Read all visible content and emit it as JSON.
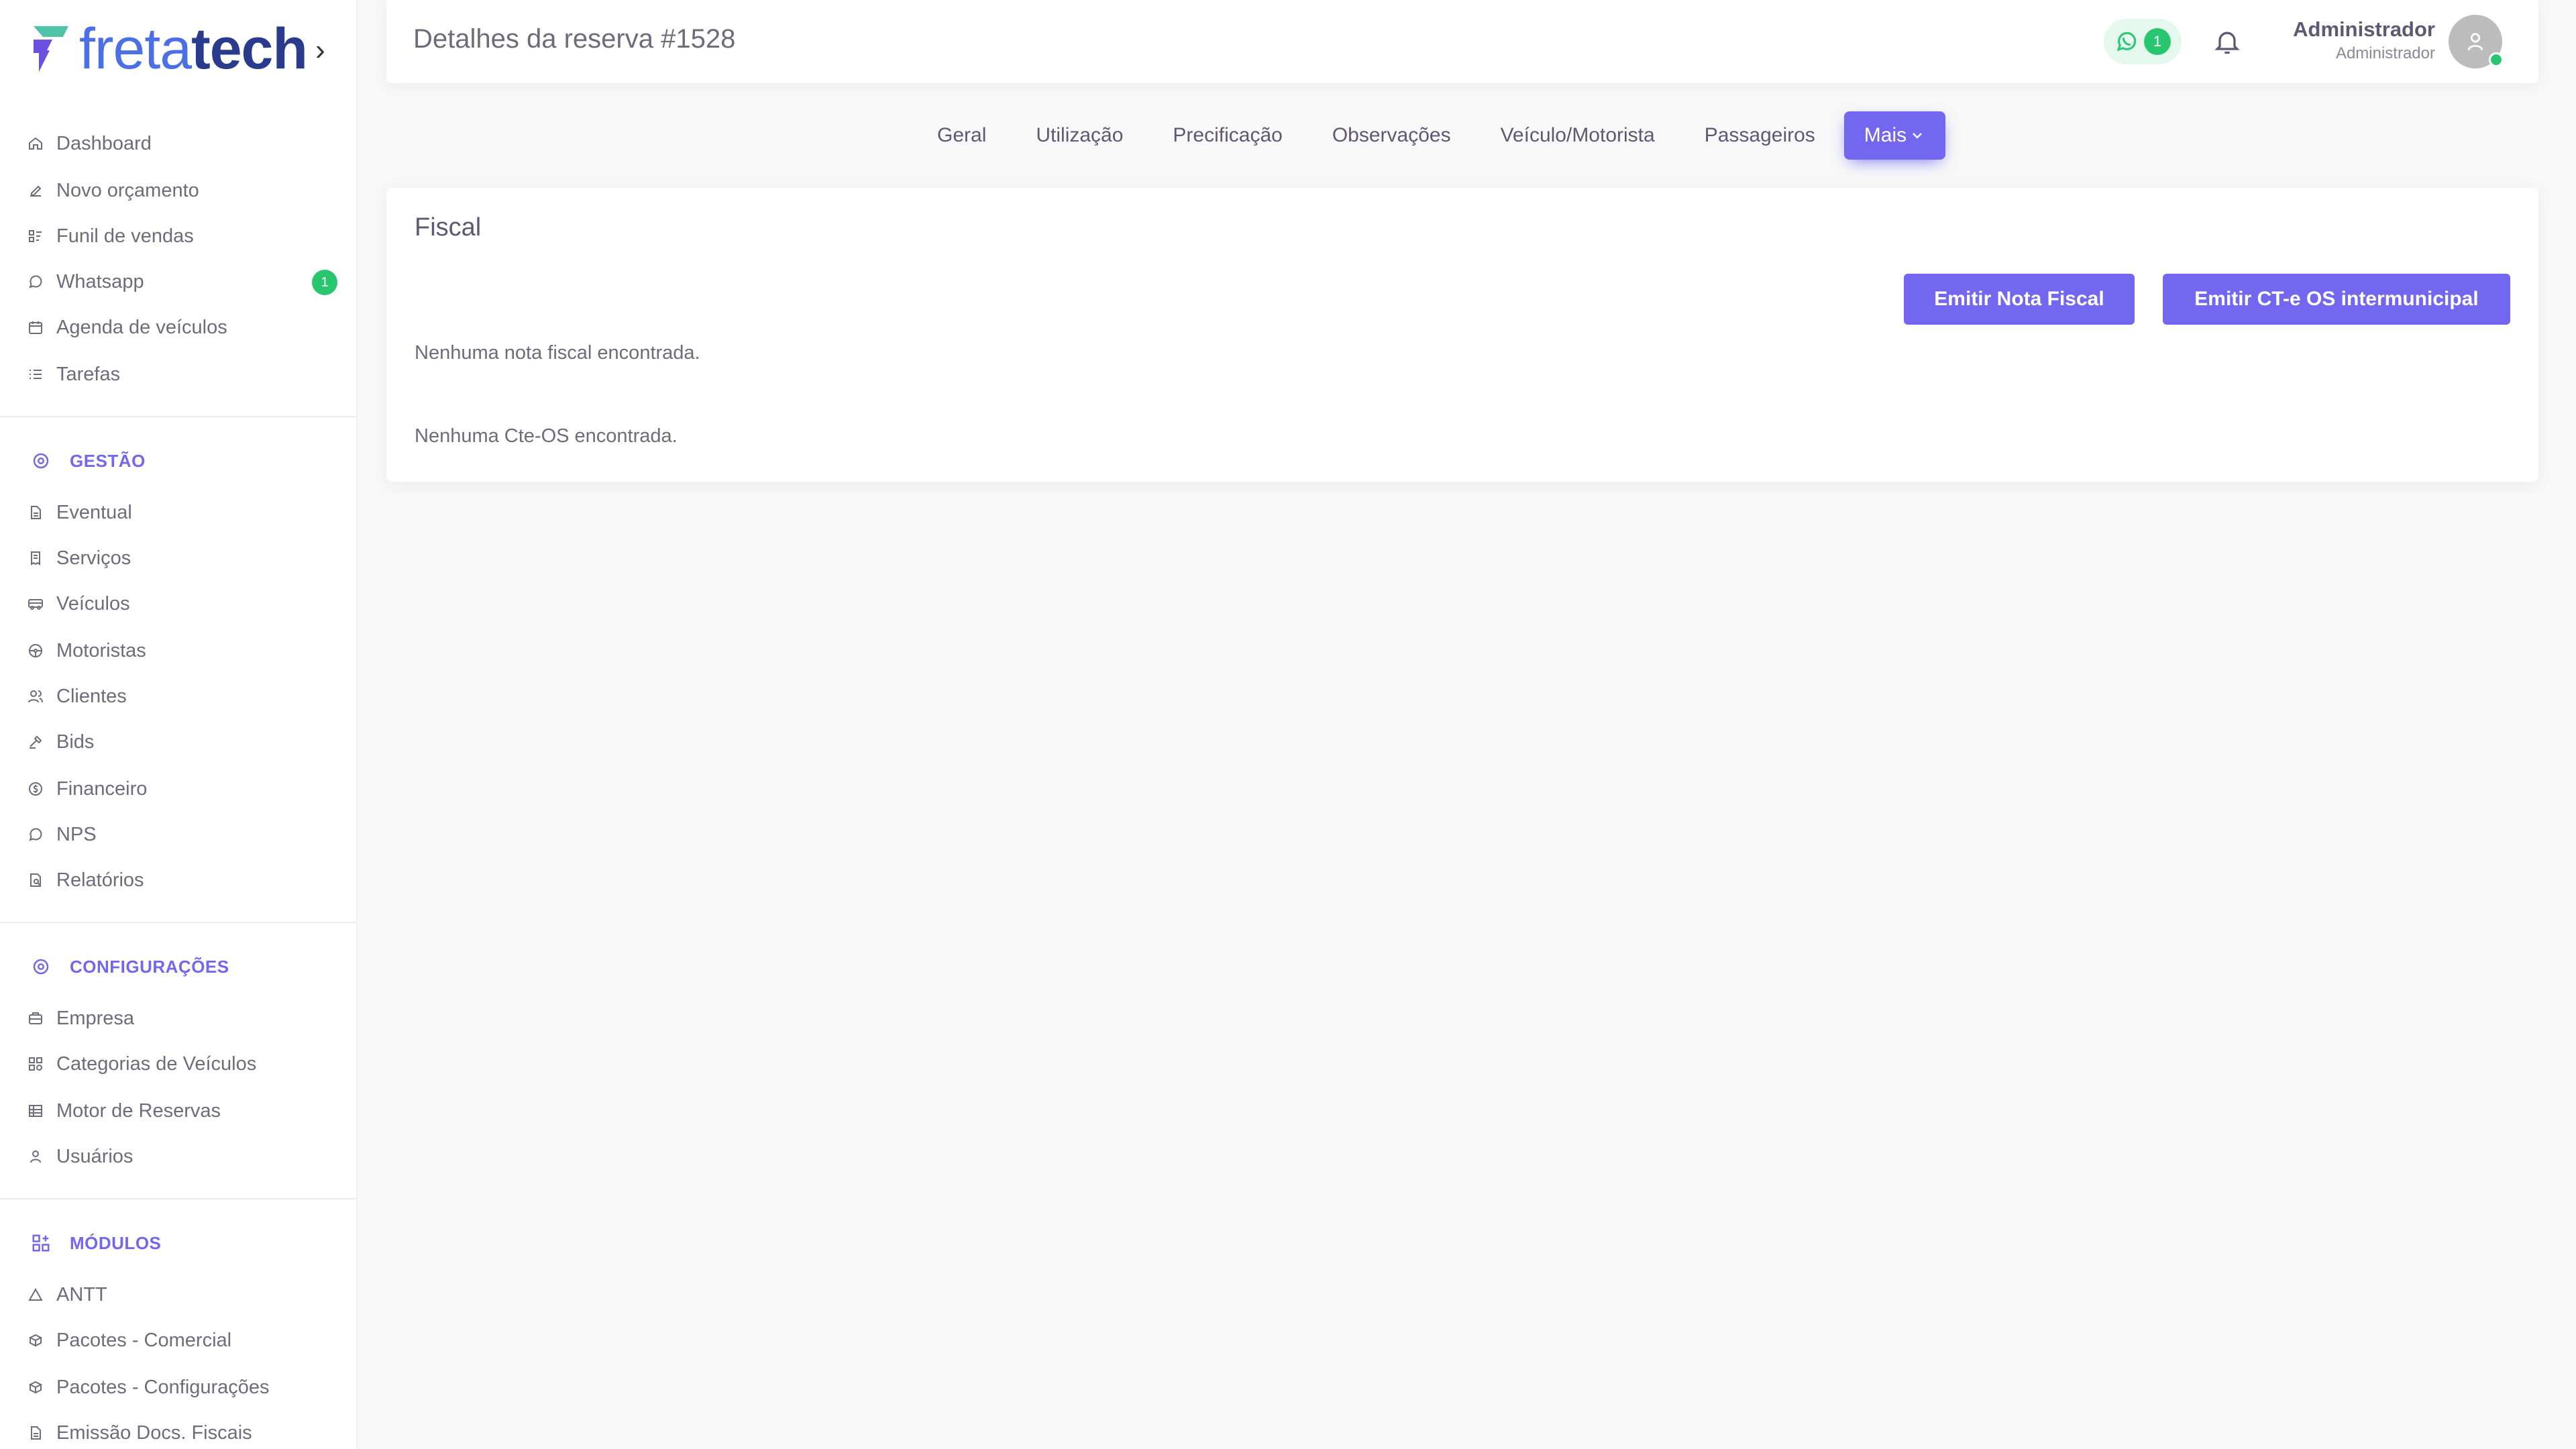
{
  "brand": {
    "logo_fr": "freta",
    "logo_tech": "tech"
  },
  "sidebar": {
    "main_items": [
      {
        "label": "Dashboard",
        "icon": "home-icon"
      },
      {
        "label": "Novo orçamento",
        "icon": "edit-icon"
      },
      {
        "label": "Funil de vendas",
        "icon": "funnel-icon"
      },
      {
        "label": "Whatsapp",
        "icon": "whatsapp-icon",
        "badge": "1"
      },
      {
        "label": "Agenda de veículos",
        "icon": "calendar-icon"
      },
      {
        "label": "Tarefas",
        "icon": "list-icon"
      }
    ],
    "gestao": {
      "title": "GESTÃO",
      "items": [
        {
          "label": "Eventual",
          "icon": "file-icon"
        },
        {
          "label": "Serviços",
          "icon": "receipt-icon"
        },
        {
          "label": "Veículos",
          "icon": "bus-icon"
        },
        {
          "label": "Motoristas",
          "icon": "steering-wheel-icon"
        },
        {
          "label": "Clientes",
          "icon": "users-icon"
        },
        {
          "label": "Bids",
          "icon": "gavel-icon"
        },
        {
          "label": "Financeiro",
          "icon": "coin-icon"
        },
        {
          "label": "NPS",
          "icon": "message-circle-icon"
        },
        {
          "label": "Relatórios",
          "icon": "report-icon"
        }
      ]
    },
    "configuracoes": {
      "title": "CONFIGURAÇÕES",
      "items": [
        {
          "label": "Empresa",
          "icon": "building-icon"
        },
        {
          "label": "Categorias de Veículos",
          "icon": "category-icon"
        },
        {
          "label": "Motor de Reservas",
          "icon": "table-icon"
        },
        {
          "label": "Usuários",
          "icon": "user-icon"
        }
      ]
    },
    "modulos": {
      "title": "MÓDULOS",
      "items": [
        {
          "label": "ANTT",
          "icon": "triangle-icon"
        },
        {
          "label": "Pacotes - Comercial",
          "icon": "package-icon"
        },
        {
          "label": "Pacotes - Configurações",
          "icon": "package-icon"
        },
        {
          "label": "Emissão Docs. Fiscais",
          "icon": "document-icon"
        }
      ]
    }
  },
  "header": {
    "title": "Detalhes da reserva #1528",
    "whatsapp_count": "1",
    "user_name": "Administrador",
    "user_role": "Administrador"
  },
  "tabs": [
    {
      "label": "Geral"
    },
    {
      "label": "Utilização"
    },
    {
      "label": "Precificação"
    },
    {
      "label": "Observações"
    },
    {
      "label": "Veículo/Motorista"
    },
    {
      "label": "Passageiros"
    },
    {
      "label": "Mais",
      "active": true
    }
  ],
  "fiscal": {
    "title": "Fiscal",
    "btn_nota_fiscal": "Emitir Nota Fiscal",
    "btn_cte": "Emitir CT-e OS intermunicipal",
    "empty_nf": "Nenhuma nota fiscal encontrada.",
    "empty_cte": "Nenhuma Cte-OS encontrada."
  },
  "colors": {
    "accent": "#7367f0",
    "success": "#28c76f"
  }
}
